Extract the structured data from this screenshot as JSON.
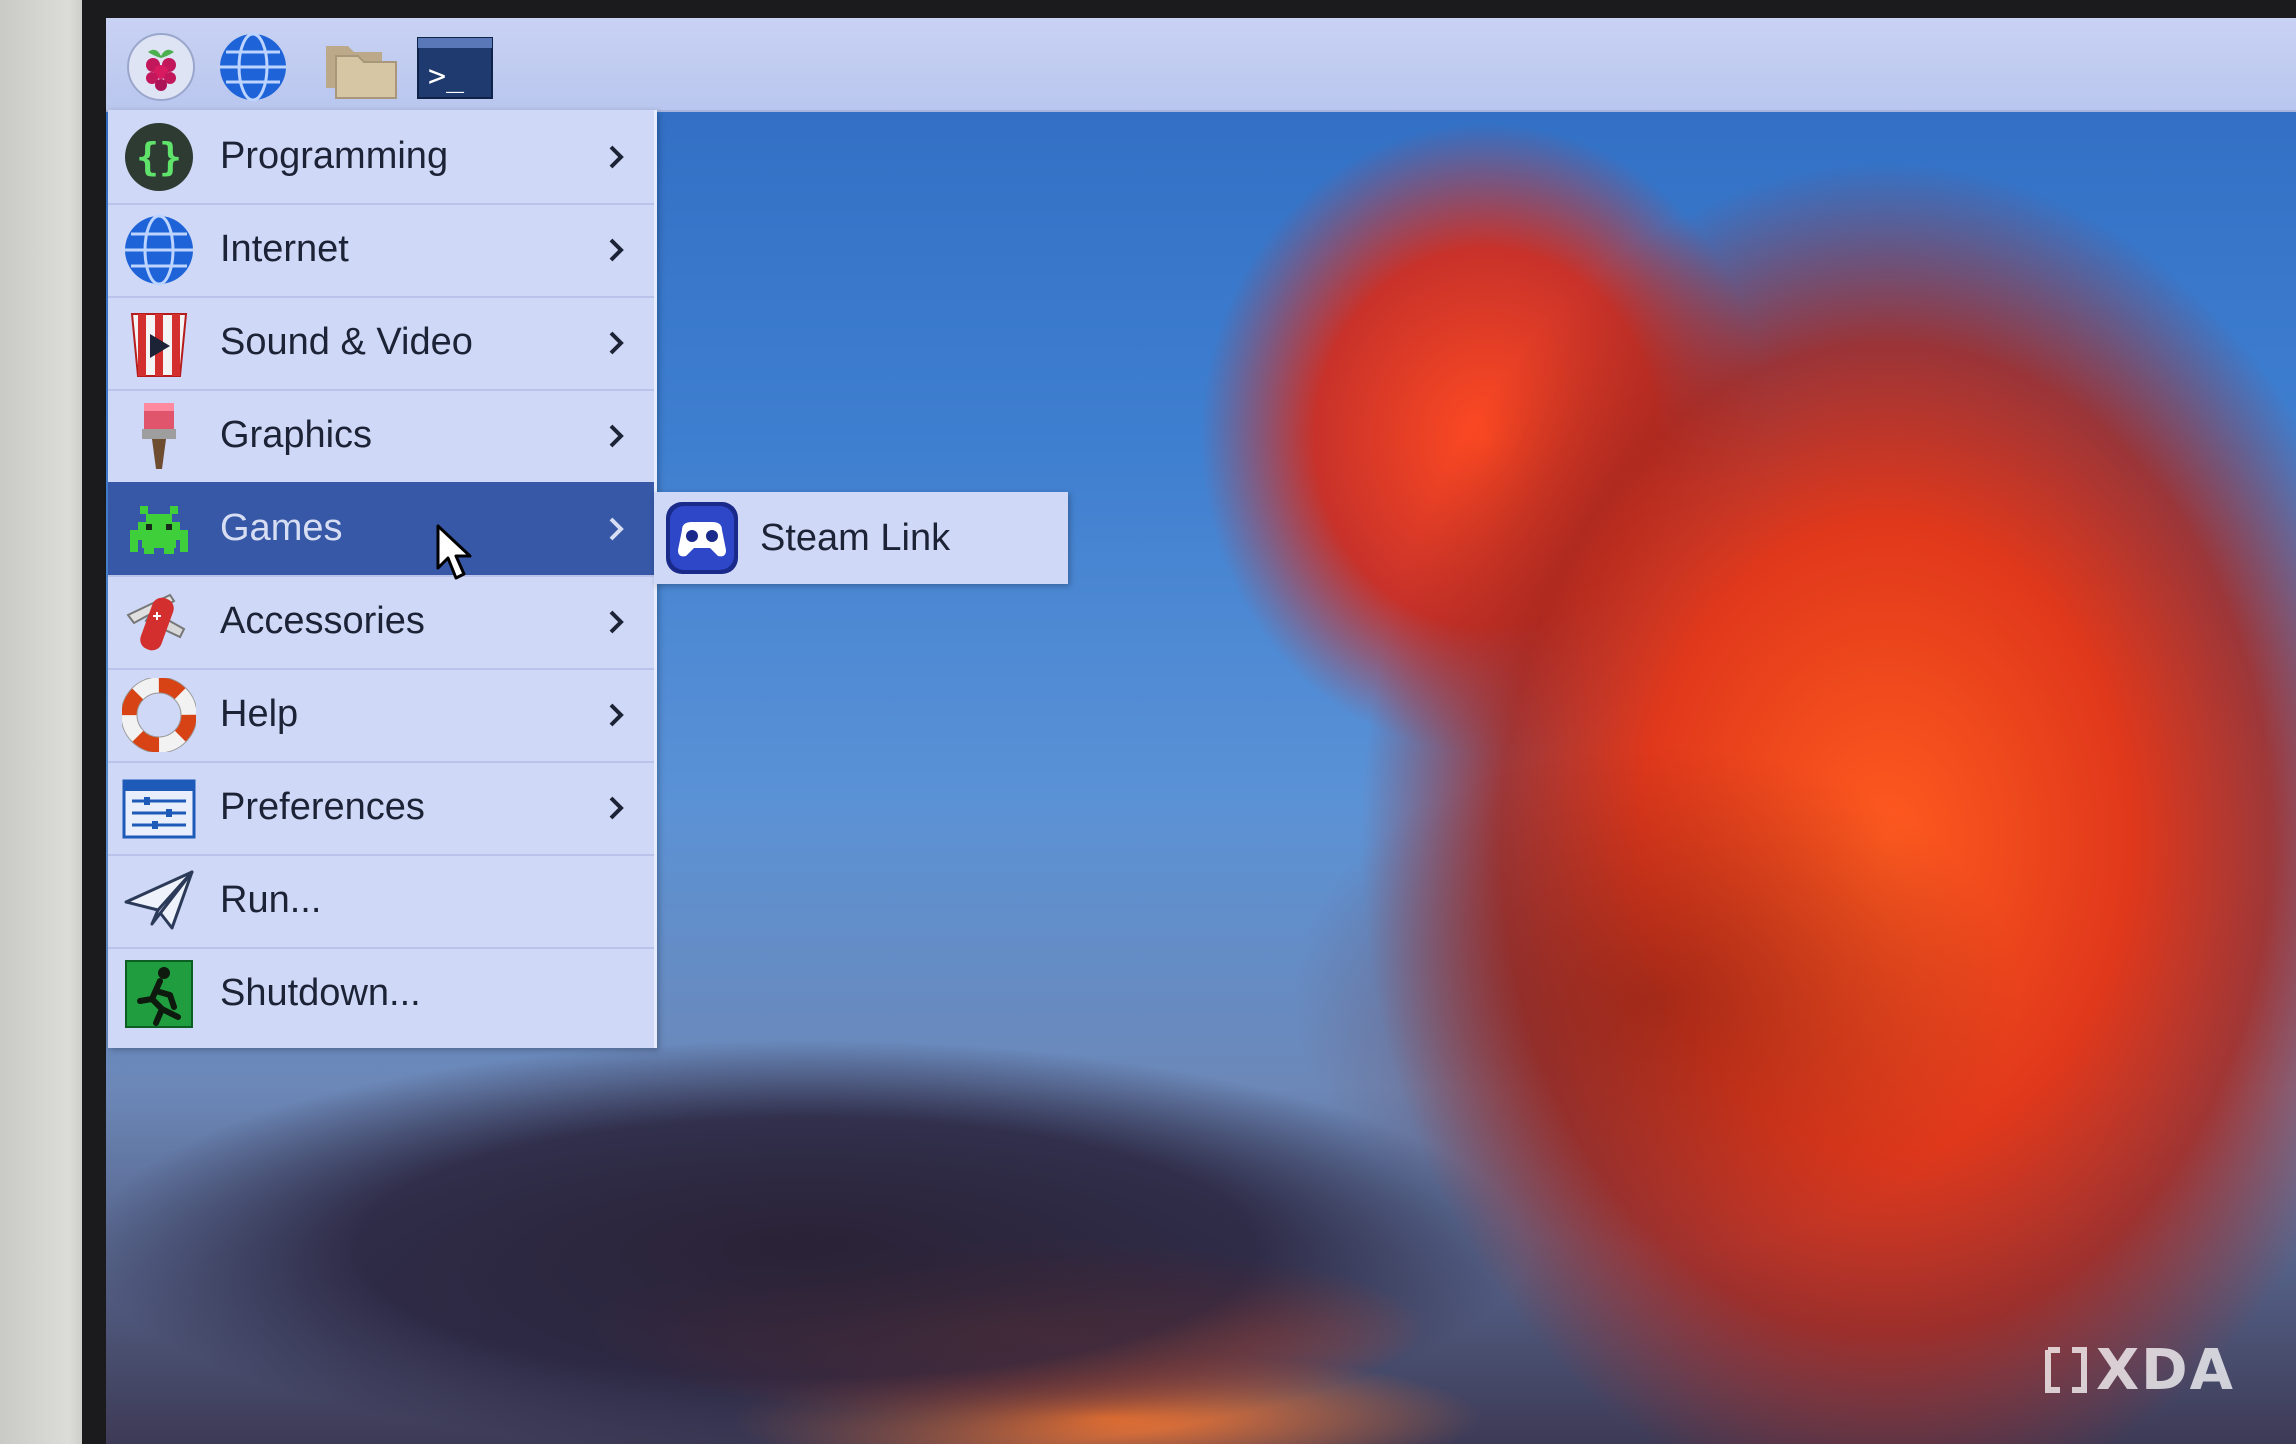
{
  "taskbar": {
    "icons": [
      "raspberry-pi-menu-icon",
      "web-browser-icon",
      "file-manager-icon",
      "terminal-icon"
    ],
    "terminal_glyph": ">_"
  },
  "menu": {
    "items": [
      {
        "label": "Programming",
        "icon": "programming-icon",
        "has_submenu": true
      },
      {
        "label": "Internet",
        "icon": "globe-icon",
        "has_submenu": true
      },
      {
        "label": "Sound & Video",
        "icon": "sound-video-icon",
        "has_submenu": true
      },
      {
        "label": "Graphics",
        "icon": "paintbrush-icon",
        "has_submenu": true
      },
      {
        "label": "Games",
        "icon": "space-invader-icon",
        "has_submenu": true,
        "active": true
      },
      {
        "label": "Accessories",
        "icon": "pocket-knife-icon",
        "has_submenu": true
      },
      {
        "label": "Help",
        "icon": "lifebuoy-icon",
        "has_submenu": true
      },
      {
        "label": "Preferences",
        "icon": "preferences-icon",
        "has_submenu": true
      },
      {
        "label": "Run...",
        "icon": "paper-plane-icon",
        "has_submenu": false
      },
      {
        "label": "Shutdown...",
        "icon": "exit-icon",
        "has_submenu": false
      }
    ]
  },
  "submenu": {
    "items": [
      {
        "label": "Steam Link",
        "icon": "steam-link-icon"
      }
    ]
  },
  "watermark": {
    "text": "XDA"
  },
  "colors": {
    "menu_bg": "#cfd8f6",
    "menu_active": "#3658a6",
    "taskbar_bg": "#c9d2f3"
  }
}
